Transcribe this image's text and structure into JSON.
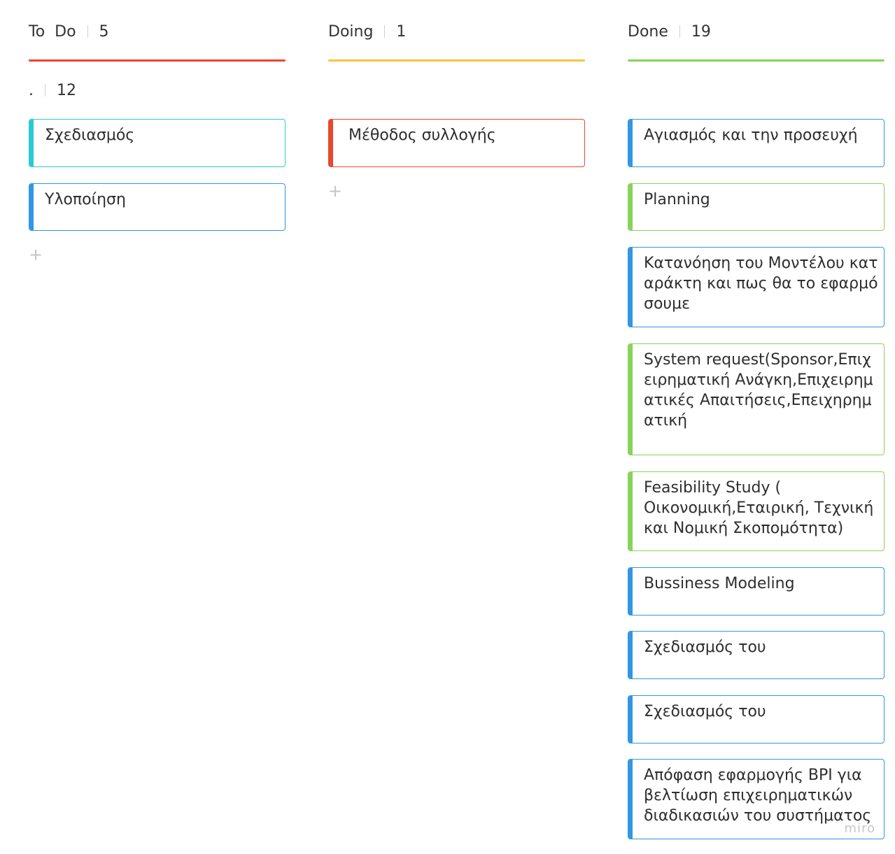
{
  "colors": {
    "todo_line": "#e8472f",
    "doing_line": "#f7c63d",
    "done_line": "#88d35a",
    "cyan": "#28cbd4",
    "blue": "#2f97e6",
    "red": "#e8472f",
    "green": "#88d35a"
  },
  "columns": [
    {
      "title": "To  Do",
      "count": "5",
      "group": {
        "label": ".",
        "count": "12"
      },
      "cards": [
        {
          "text": "Σχεδιασμός",
          "color": "cyan"
        },
        {
          "text": "Υλοποίηση",
          "color": "blue"
        }
      ],
      "add_icon": "plus-icon",
      "add_label": "+"
    },
    {
      "title": "Doing",
      "count": "1",
      "cards": [
        {
          "text": "Μέθοδος συλλογής",
          "color": "red"
        }
      ],
      "add_icon": "plus-icon",
      "add_label": "+"
    },
    {
      "title": "Done",
      "count": "19",
      "cards": [
        {
          "text": "Αγιασμός και την προσευχή",
          "color": "blue"
        },
        {
          "text": "Planning",
          "color": "green"
        },
        {
          "text": "Κατανόηση του Μοντέλου καταράκτη και πως θα το εφαρμόσουμε",
          "color": "blue"
        },
        {
          "text": "System request(Sponsor,Επιχειρηματική Ανάγκη,Επιχειρηματικές Απαιτήσεις,Επειχηρηματική",
          "color": "green"
        },
        {
          "text": "Feasibility Study ( Οικονομική,Εταιρική, Τεχνική και Νομική Σκοπομότητα)",
          "color": "green"
        },
        {
          "text": "Bussiness Modeling",
          "color": "blue"
        },
        {
          "text": "Σχεδιασμός του",
          "color": "blue"
        },
        {
          "text": "Σχεδιασμός του",
          "color": "blue"
        },
        {
          "text": "Απόφαση εφαρμογής BPI για βελτίωση επιχειρηματικών διαδικασιών του συστήματος",
          "color": "blue"
        }
      ]
    }
  ],
  "watermark": "miro"
}
